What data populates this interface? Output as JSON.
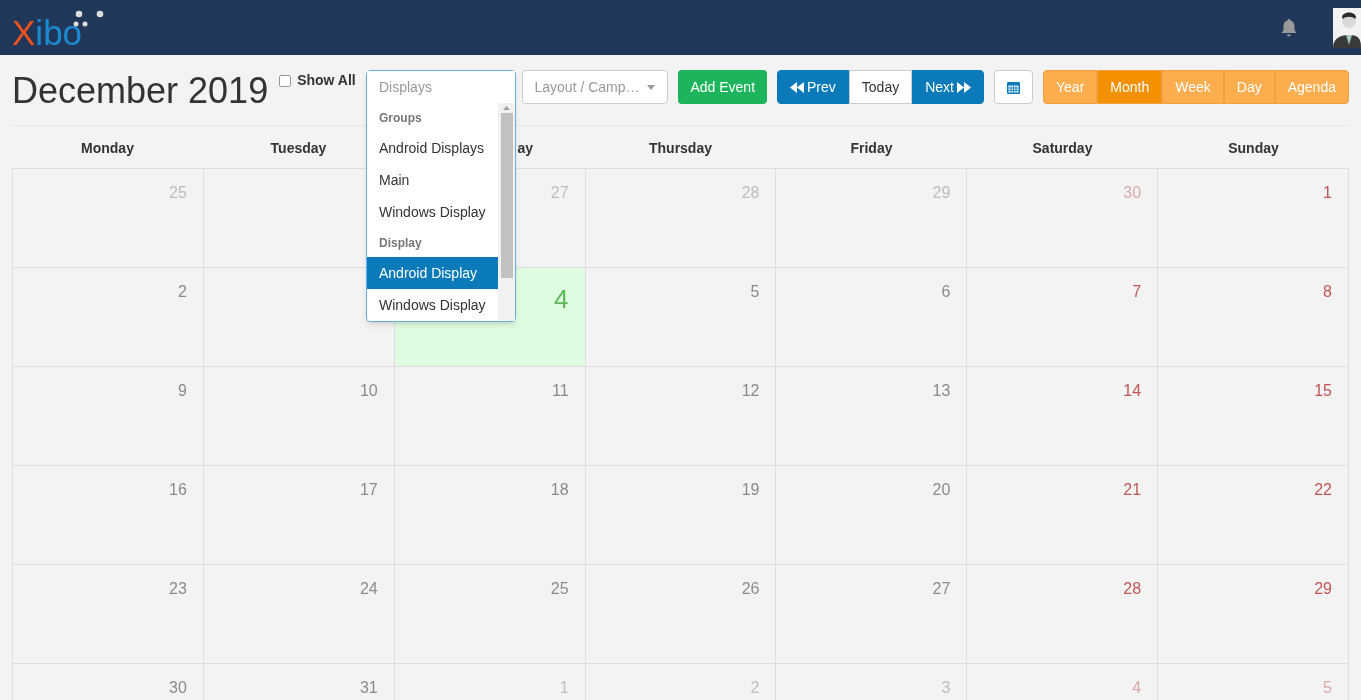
{
  "navbar": {
    "logo": {
      "first": "X",
      "rest": "ibo"
    }
  },
  "header": {
    "title": "December 2019",
    "show_all": {
      "label": "Show All",
      "checked": false
    },
    "display_select": {
      "placeholder": "Displays",
      "open": true,
      "options": [
        {
          "kind": "group",
          "label": "Groups"
        },
        {
          "kind": "option",
          "label": "Android Displays",
          "selected": false
        },
        {
          "kind": "option",
          "label": "Main",
          "selected": false
        },
        {
          "kind": "option",
          "label": "Windows Display",
          "selected": false
        },
        {
          "kind": "group",
          "label": "Display"
        },
        {
          "kind": "option",
          "label": "Android Display",
          "selected": true
        },
        {
          "kind": "option",
          "label": "Windows Display",
          "selected": false
        }
      ]
    },
    "layout_select": {
      "placeholder": "Layout / Camp…"
    },
    "add_event": "Add Event",
    "nav": [
      {
        "kind": "prev",
        "label": "Prev"
      },
      {
        "kind": "today",
        "label": "Today"
      },
      {
        "kind": "next",
        "label": "Next"
      }
    ],
    "views": [
      {
        "label": "Year",
        "selected": false
      },
      {
        "label": "Month",
        "selected": true
      },
      {
        "label": "Week",
        "selected": false
      },
      {
        "label": "Day",
        "selected": false
      },
      {
        "label": "Agenda",
        "selected": false
      }
    ]
  },
  "calendar": {
    "weekdays": [
      {
        "label": "Monday"
      },
      {
        "label": "Tuesday"
      },
      {
        "label": "ay",
        "partial": true
      },
      {
        "label": "Thursday"
      },
      {
        "label": "Friday"
      },
      {
        "label": "Saturday"
      },
      {
        "label": "Sunday"
      }
    ],
    "weeks": [
      [
        {
          "day": "25",
          "muted": true,
          "today": false
        },
        {
          "today": false
        },
        {
          "day": "27",
          "muted": true,
          "today": false
        },
        {
          "day": "28",
          "muted": true,
          "today": false
        },
        {
          "day": "29",
          "muted": true,
          "today": false
        },
        {
          "day": "30",
          "muted": true,
          "today": false
        },
        {
          "day": "1",
          "muted": false,
          "today": false
        }
      ],
      [
        {
          "day": "2",
          "muted": false,
          "today": false
        },
        {
          "today": false
        },
        {
          "day": "4",
          "muted": false,
          "today": true
        },
        {
          "day": "5",
          "muted": false,
          "today": false
        },
        {
          "day": "6",
          "muted": false,
          "today": false
        },
        {
          "day": "7",
          "muted": false,
          "today": false
        },
        {
          "day": "8",
          "muted": false,
          "today": false
        }
      ],
      [
        {
          "day": "9",
          "muted": false,
          "today": false
        },
        {
          "day": "10",
          "muted": false,
          "today": false
        },
        {
          "day": "11",
          "muted": false,
          "today": false
        },
        {
          "day": "12",
          "muted": false,
          "today": false
        },
        {
          "day": "13",
          "muted": false,
          "today": false
        },
        {
          "day": "14",
          "muted": false,
          "today": false
        },
        {
          "day": "15",
          "muted": false,
          "today": false
        }
      ],
      [
        {
          "day": "16",
          "muted": false,
          "today": false
        },
        {
          "day": "17",
          "muted": false,
          "today": false
        },
        {
          "day": "18",
          "muted": false,
          "today": false
        },
        {
          "day": "19",
          "muted": false,
          "today": false
        },
        {
          "day": "20",
          "muted": false,
          "today": false
        },
        {
          "day": "21",
          "muted": false,
          "today": false
        },
        {
          "day": "22",
          "muted": false,
          "today": false
        }
      ],
      [
        {
          "day": "23",
          "muted": false,
          "today": false
        },
        {
          "day": "24",
          "muted": false,
          "today": false
        },
        {
          "day": "25",
          "muted": false,
          "today": false
        },
        {
          "day": "26",
          "muted": false,
          "today": false
        },
        {
          "day": "27",
          "muted": false,
          "today": false
        },
        {
          "day": "28",
          "muted": false,
          "today": false
        },
        {
          "day": "29",
          "muted": false,
          "today": false
        }
      ],
      [
        {
          "day": "30",
          "muted": false,
          "today": false
        },
        {
          "day": "31",
          "muted": false,
          "today": false
        },
        {
          "day": "1",
          "muted": true,
          "today": false
        },
        {
          "day": "2",
          "muted": true,
          "today": false
        },
        {
          "day": "3",
          "muted": true,
          "today": false
        },
        {
          "day": "4",
          "muted": true,
          "today": false
        },
        {
          "day": "5",
          "muted": true,
          "today": false
        }
      ]
    ]
  }
}
